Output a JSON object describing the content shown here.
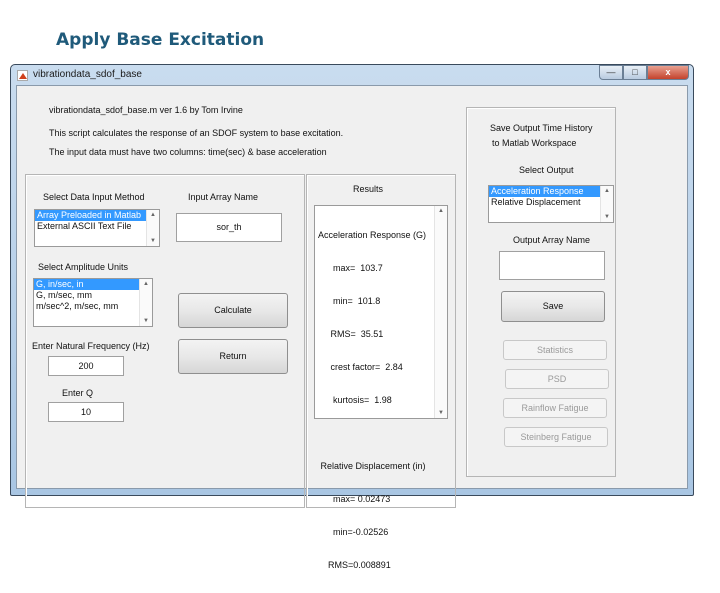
{
  "slide": {
    "title": "Apply Base Excitation"
  },
  "window": {
    "title": "vibrationdata_sdof_base",
    "controls": {
      "minimize": "—",
      "maximize": "□",
      "close": "x"
    }
  },
  "header": {
    "version_line": "vibrationdata_sdof_base.m   ver 1.6  by Tom Irvine",
    "description_1": "This script calculates the response of an SDOF system to base excitation.",
    "description_2": "The input data must have two columns:  time(sec) & base acceleration"
  },
  "input_panel": {
    "input_method_label": "Select Data Input Method",
    "input_method_options": [
      "Array Preloaded in Matlab",
      "External ASCII Text File"
    ],
    "input_method_selected": 0,
    "array_name_label": "Input Array Name",
    "array_name_value": "sor_th",
    "amplitude_units_label": "Select Amplitude Units",
    "amplitude_units_options": [
      "G, in/sec, in",
      "G, m/sec, mm",
      "m/sec^2, m/sec, mm"
    ],
    "amplitude_units_selected": 0,
    "calculate_label": "Calculate",
    "natural_freq_label": "Enter Natural Frequency (Hz)",
    "natural_freq_value": "200",
    "q_label": "Enter Q",
    "q_value": "10",
    "return_label": "Return"
  },
  "results_panel": {
    "title": "Results",
    "lines": [
      "Acceleration Response (G)",
      "      max=  103.7",
      "      min=  101.8",
      "     RMS=  35.51",
      "     crest factor=  2.84",
      "      kurtosis=  1.98",
      "",
      " Relative Displacement (in)",
      "      max= 0.02473",
      "      min=-0.02526",
      "    RMS=0.008891"
    ]
  },
  "output_panel": {
    "save_label_1": "Save Output Time History",
    "save_label_2": "to Matlab Workspace",
    "select_output_label": "Select Output",
    "output_options": [
      "Acceleration Response",
      "Relative Displacement"
    ],
    "output_selected": 0,
    "output_array_label": "Output Array Name",
    "output_array_value": "",
    "save_button": "Save",
    "statistics_button": "Statistics",
    "psd_button": "PSD",
    "rainflow_button": "Rainflow Fatigue",
    "steinberg_button": "Steinberg Fatigue"
  }
}
